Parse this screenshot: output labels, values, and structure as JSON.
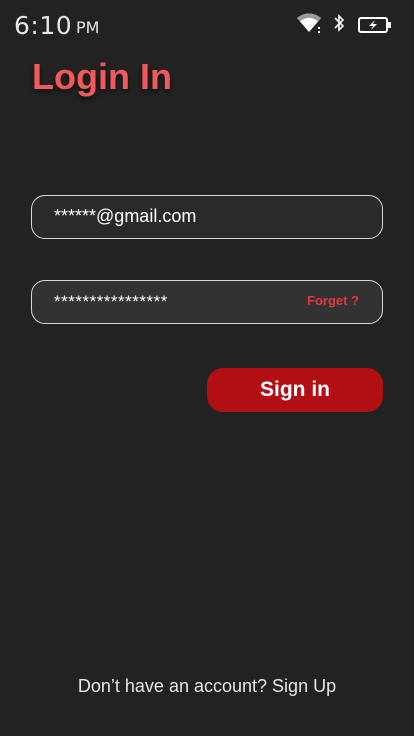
{
  "status_bar": {
    "time": "6:10",
    "ampm": "PM",
    "icons": [
      "wifi-icon",
      "bluetooth-icon",
      "battery-charging-icon"
    ]
  },
  "title": "Login In",
  "email_field": {
    "value": "******@gmail.com"
  },
  "password_field": {
    "value": "****************",
    "forget_label": "Forget ?"
  },
  "signin_button": {
    "label": "Sign in"
  },
  "footer": {
    "prompt": "Don’t have an account?",
    "signup_label": "Sign Up"
  },
  "colors": {
    "background": "#222222",
    "title": "#f05a5a",
    "button": "#b20f14",
    "forget": "#e03a3a"
  }
}
